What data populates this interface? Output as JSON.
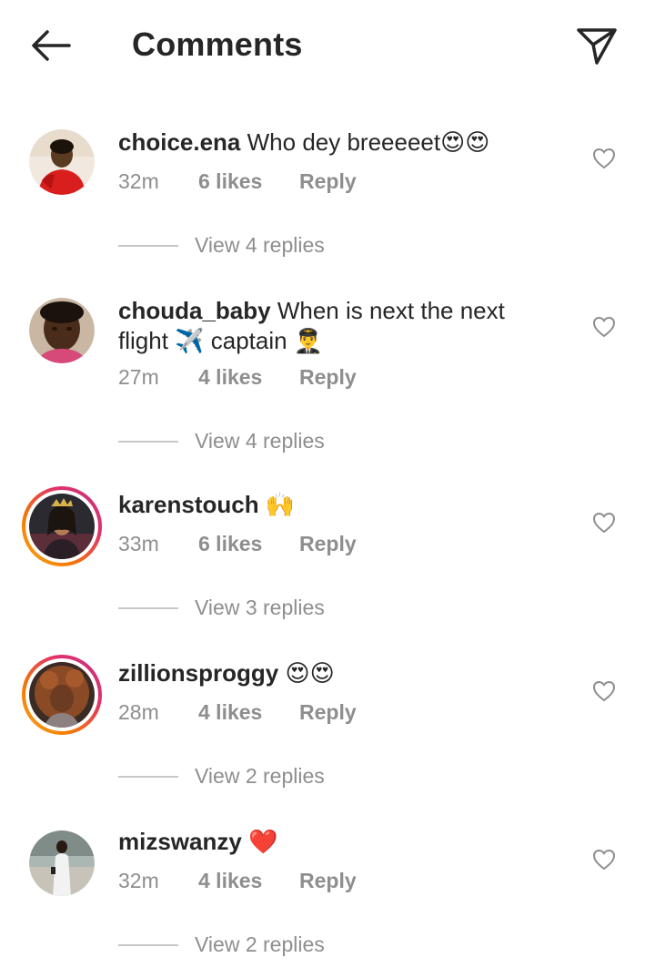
{
  "header": {
    "title": "Comments",
    "back_icon": "arrow-left-icon",
    "share_icon": "paper-plane-icon"
  },
  "colors": {
    "text": "#262626",
    "muted": "#8e8e8e",
    "divider": "#c7c7c7",
    "story_ring_start": "#f9a825",
    "story_ring_end": "#c13584",
    "heart_red": "#e0245e"
  },
  "comments": [
    {
      "username": "choice.ena",
      "text": "Who dey breeeeet",
      "emoji": "😍😍",
      "time": "32m",
      "likes": "6 likes",
      "reply": "Reply",
      "view_replies": "View 4 replies",
      "has_story": false
    },
    {
      "username": "chouda_baby",
      "text": "When is next the next flight",
      "emoji": "✈️",
      "text2": "captain",
      "emoji2": "👨‍✈️",
      "time": "27m",
      "likes": "4 likes",
      "reply": "Reply",
      "view_replies": "View 4 replies",
      "has_story": false
    },
    {
      "username": "karenstouch",
      "text": "",
      "emoji": "🙌",
      "time": "33m",
      "likes": "6 likes",
      "reply": "Reply",
      "view_replies": "View 3 replies",
      "has_story": true
    },
    {
      "username": "zillionsproggy",
      "text": "",
      "emoji": "😍😍",
      "time": "28m",
      "likes": "4 likes",
      "reply": "Reply",
      "view_replies": "View 2 replies",
      "has_story": true
    },
    {
      "username": "mizswanzy",
      "text": "",
      "emoji": "❤️",
      "time": "32m",
      "likes": "4 likes",
      "reply": "Reply",
      "view_replies": "View 2 replies",
      "has_story": false
    }
  ]
}
